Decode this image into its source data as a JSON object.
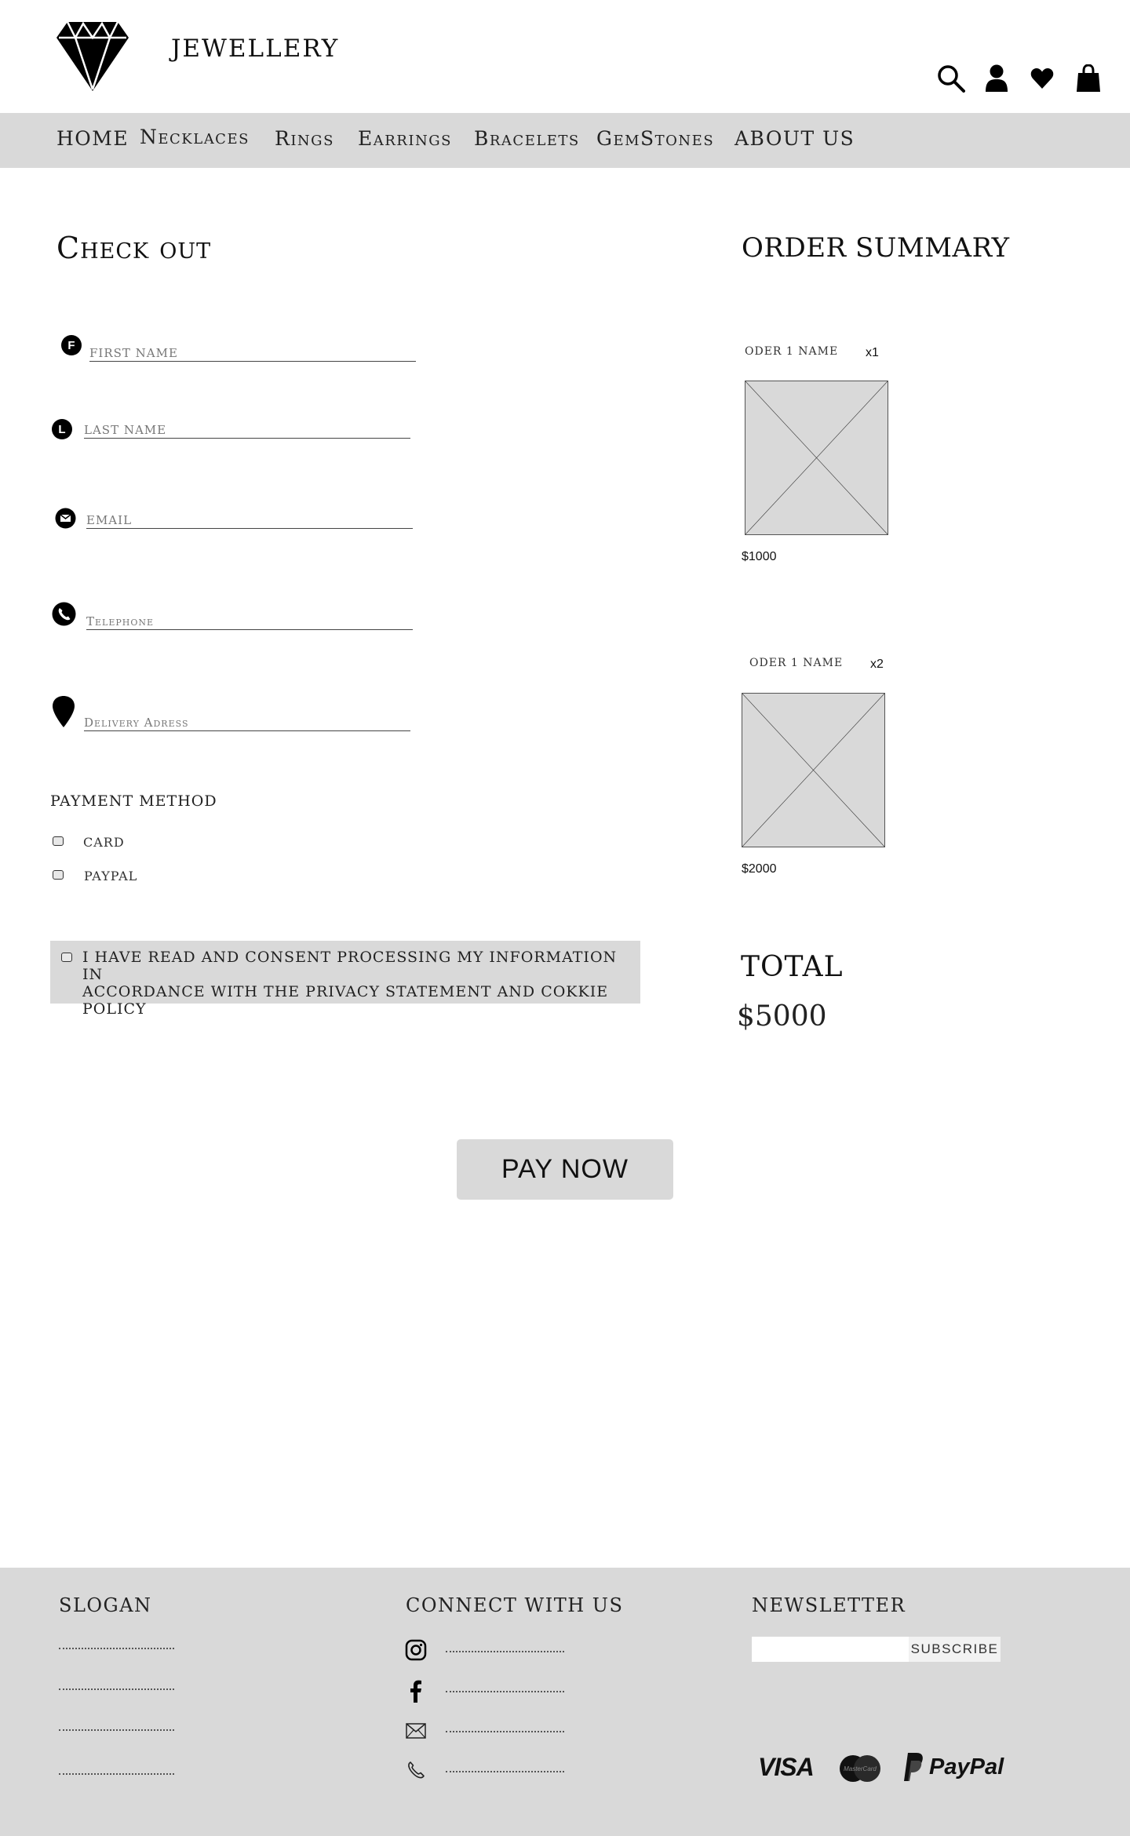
{
  "header": {
    "brand_name": "JEWELLERY",
    "icons": [
      "search-icon",
      "user-icon",
      "heart-icon",
      "bag-icon"
    ]
  },
  "nav": {
    "items": [
      "HOME",
      "Necklaces",
      "Rings",
      "Earrings",
      "Bracelets",
      "GemStones",
      "ABOUT US"
    ]
  },
  "checkout": {
    "title": "Check out",
    "fields": {
      "first_name": {
        "placeholder": "FIRST NAME",
        "icon_letter": "F"
      },
      "last_name": {
        "placeholder": "LAST NAME",
        "icon_letter": "L"
      },
      "email": {
        "placeholder": "EMAIL"
      },
      "telephone": {
        "placeholder": "Telephone"
      },
      "address": {
        "placeholder": "Delivery Adress"
      }
    },
    "payment": {
      "title": "PAYMENT METHOD",
      "options": [
        "CARD",
        "PAYPAL"
      ]
    },
    "consent": {
      "line1": "I HAVE READ AND CONSENT PROCESSING MY INFORMATION IN",
      "line2": "ACCORDANCE WITH THE PRIVACY STATEMENT AND COKKIE POLICY"
    },
    "pay_button": "PAY NOW"
  },
  "summary": {
    "title": "ORDER SUMMARY",
    "items": [
      {
        "name": "ODER 1 NAME",
        "qty": "x1",
        "price": "$1000"
      },
      {
        "name": "ODER 1 NAME",
        "qty": "x2",
        "price": "$2000"
      }
    ],
    "total_label": "TOTAL",
    "total_value": "$5000"
  },
  "footer": {
    "slogan_title": "SLOGAN",
    "connect_title": "CONNECT WITH US",
    "newsletter_title": "NEWSLETTER",
    "subscribe_label": "SUBSCRIBE",
    "social_icons": [
      "instagram-icon",
      "facebook-icon",
      "mail-icon",
      "phone-icon"
    ],
    "payment_logos": {
      "visa": "VISA",
      "mastercard": "MasterCard",
      "paypal": "PayPal"
    }
  }
}
